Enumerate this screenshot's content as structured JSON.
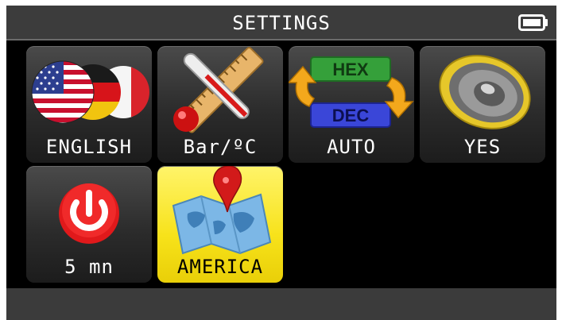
{
  "header": {
    "title": "SETTINGS",
    "battery_icon": "battery-icon"
  },
  "tiles": [
    {
      "label": "ENGLISH",
      "icon": "flags-icon"
    },
    {
      "label": "Bar/ºC",
      "icon": "thermometer-ruler-icon"
    },
    {
      "label": "AUTO",
      "icon": "hex-dec-icon",
      "icon_texts": [
        "HEX",
        "DEC"
      ]
    },
    {
      "label": "YES",
      "icon": "speaker-icon"
    },
    {
      "label": "5 mn",
      "icon": "power-icon"
    },
    {
      "label": "AMERICA",
      "icon": "map-pin-icon",
      "selected": true
    }
  ],
  "colors": {
    "header_bg": "#3c3c3c",
    "content_bg": "#000000",
    "tile_bg": "#2c2c2c",
    "selected_tile_bg": "#f7e21a"
  }
}
